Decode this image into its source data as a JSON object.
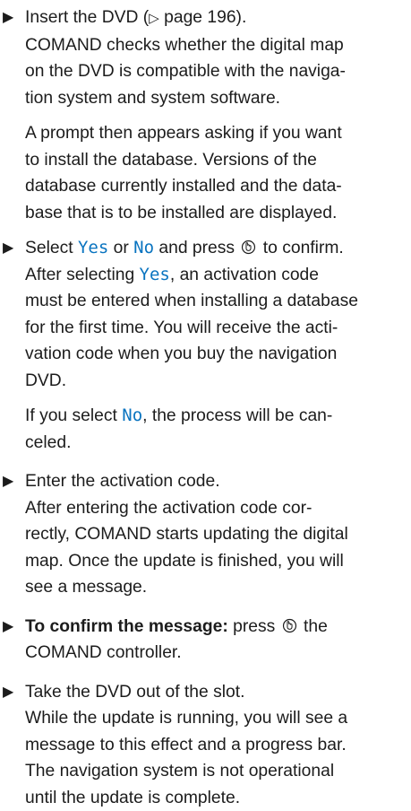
{
  "steps": [
    {
      "lines": [
        {
          "a": "Insert the DVD (",
          "b": "▷",
          "c": " page 196)."
        }
      ],
      "body": [
        "COMAND checks whether the digital map",
        "on the DVD is compatible with the naviga-",
        "tion system and system software."
      ]
    },
    {
      "para": [
        "A prompt then appears asking if you want",
        "to install the database. Versions of the",
        "database currently installed and the data-",
        "base that is to be installed are displayed."
      ]
    },
    {
      "l1_a": "Select ",
      "l1_yes": "Yes",
      "l1_b": " or ",
      "l1_no": "No",
      "l1_c": " and press ",
      "l1_d": " to confirm.",
      "l2_a": "After selecting ",
      "l2_yes": "Yes",
      "l2_b": ", an activation code",
      "rest": [
        "must be entered when installing a database",
        "for the first time. You will receive the acti-",
        "vation code when you buy the navigation",
        "DVD."
      ]
    },
    {
      "p1_a": "If you select ",
      "p1_no": "No",
      "p1_b": ", the process will be can-",
      "p2": "celed."
    },
    {
      "head": "Enter the activation code.",
      "body": [
        "After entering the activation code cor-",
        "rectly, COMAND starts updating the digital",
        "map. Once the update is finished, you will",
        "see a message."
      ]
    },
    {
      "bold": "To confirm the message:",
      "after": " press ",
      "after2": " the",
      "l2": "COMAND controller."
    },
    {
      "head": "Take the DVD out of the slot.",
      "body": [
        "While the update is running, you will see a",
        "message to this effect and a progress bar.",
        "The navigation system is not operational",
        "until the update is complete."
      ]
    }
  ],
  "icons": {
    "step": "step-arrow-icon",
    "controller": "controller-press-icon",
    "ref": "page-reference-icon"
  },
  "colors": {
    "option_text": "#0a74c0",
    "text": "#1c1c1c"
  }
}
